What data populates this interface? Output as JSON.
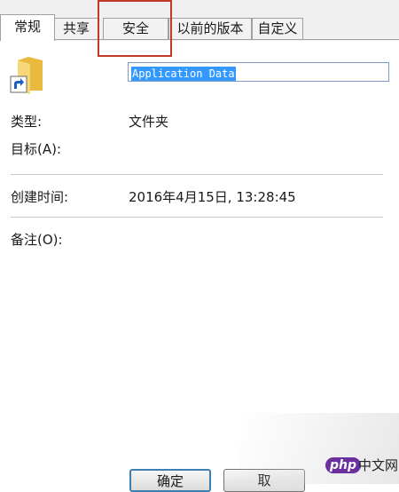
{
  "tabs": [
    {
      "label": "常规",
      "active": true
    },
    {
      "label": "共享",
      "active": false
    },
    {
      "label": "安全",
      "active": false
    },
    {
      "label": "以前的版本",
      "active": false
    },
    {
      "label": "自定义",
      "active": false
    }
  ],
  "general": {
    "name_value": "Application Data",
    "type_label": "类型:",
    "type_value": "文件夹",
    "target_label": "目标(A):",
    "created_label": "创建时间:",
    "created_value": "2016年4月15日, 13:28:45",
    "comment_label": "备注(O):"
  },
  "buttons": {
    "ok_label": "确定",
    "cancel_label": "取"
  },
  "watermark": {
    "php": "php",
    "site": "中文网"
  },
  "colors": {
    "highlight_box": "#c0392b",
    "selection": "#3399ff",
    "folder": "#f2c94c"
  }
}
